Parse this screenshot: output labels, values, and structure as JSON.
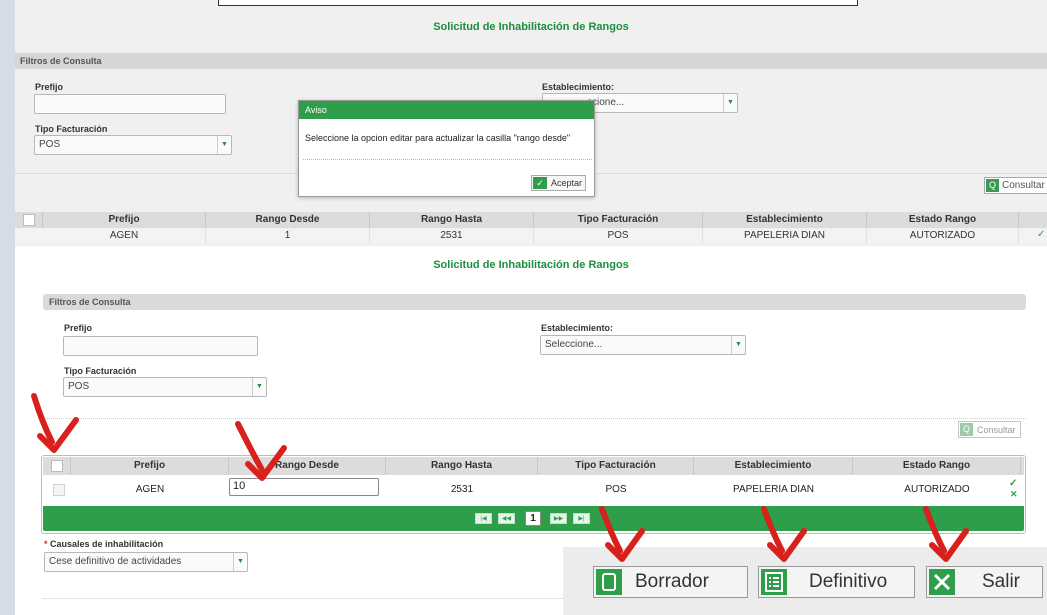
{
  "top_panel": {
    "title": "Solicitud de Inhabilitación de Rangos",
    "filters_title": "Filtros de Consulta",
    "prefijo_label": "Prefijo",
    "prefijo_value": "",
    "establecimiento_label": "Establecimiento:",
    "establecimiento_value": "ccione...",
    "tipo_label": "Tipo Facturación",
    "tipo_value": "POS",
    "consultar_label": "Consultar",
    "table": {
      "headers": [
        "Prefijo",
        "Rango Desde",
        "Rango Hasta",
        "Tipo Facturación",
        "Establecimiento",
        "Estado Rango"
      ],
      "row": [
        "AGEN",
        "1",
        "2531",
        "POS",
        "PAPELERIA DIAN",
        "AUTORIZADO"
      ]
    },
    "modal": {
      "title": "Aviso",
      "message": "Seleccione la opcion editar para actualizar la casilla \"rango desde\"",
      "button": "Aceptar"
    }
  },
  "main_panel": {
    "title": "Solicitud de Inhabilitación de Rangos",
    "filters_title": "Filtros de Consulta",
    "prefijo_label": "Prefijo",
    "prefijo_value": "",
    "establecimiento_label": "Establecimiento:",
    "establecimiento_value": "Seleccione...",
    "tipo_label": "Tipo Facturación",
    "tipo_value": "POS",
    "consultar_label": "Consultar",
    "table": {
      "headers": [
        "Prefijo",
        "Rango Desde",
        "Rango Hasta",
        "Tipo Facturación",
        "Establecimiento",
        "Estado Rango"
      ],
      "row": {
        "prefijo": "AGEN",
        "rango_desde": "10",
        "rango_hasta": "2531",
        "tipo": "POS",
        "establecimiento": "PAPELERIA DIAN",
        "estado": "AUTORIZADO"
      },
      "current_page": "1"
    },
    "causales_label": "Causales de inhabilitación",
    "causales_value": "Cese definitivo de actividades"
  },
  "actions": {
    "borrador": "Borrador",
    "definitivo": "Definitivo",
    "salir": "Salir"
  },
  "colors": {
    "accent_green": "#2f9e4a",
    "title_green": "#1a8f3e",
    "annotation_red": "#d8201c"
  }
}
